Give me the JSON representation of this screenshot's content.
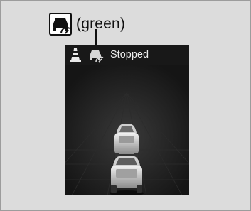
{
  "callout": {
    "icon": "acc-vehicle-ahead-icon",
    "label": "(green)"
  },
  "display": {
    "status_text": "Stopped",
    "icons": [
      "lane-keeping-icon",
      "acc-vehicle-ahead-icon"
    ]
  },
  "colors": {
    "background": "#dcdcdc",
    "display_background": "#1b1b1b",
    "text": "#ececec"
  }
}
